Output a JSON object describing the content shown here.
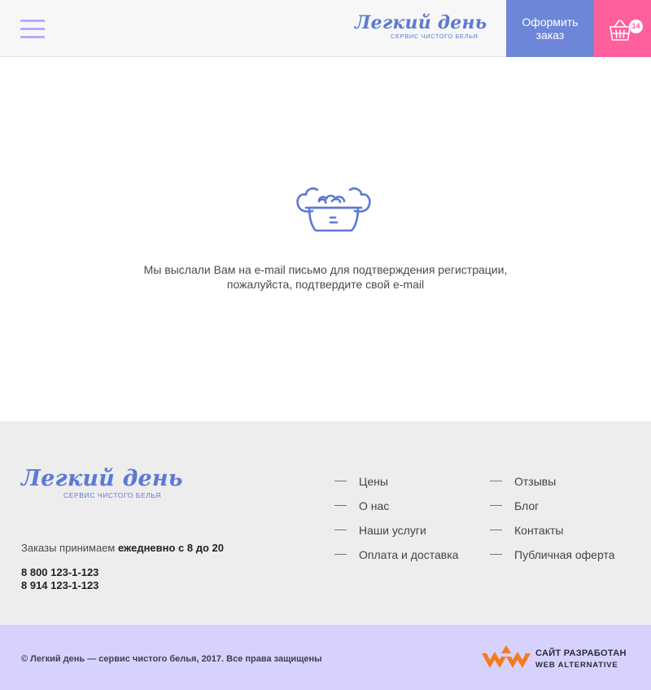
{
  "header": {
    "logo_main": "Легкий день",
    "logo_sub": "СЕРВИС ЧИСТОГО БЕЛЬЯ",
    "order_button": "Оформить заказ",
    "cart_count": "14"
  },
  "main": {
    "icon": "laundry-basin-icon",
    "message_line1": "Мы выслали Вам на e-mail письмо для подтверждения регистрации,",
    "message_line2": "пожалуйста, подтвердите свой e-mail"
  },
  "footer": {
    "logo_main": "Легкий день",
    "logo_sub": "СЕРВИС ЧИСТОГО БЕЛЬЯ",
    "orders_prefix": "Заказы  принимаем ",
    "orders_bold": "ежедневно с 8 до 20",
    "phone1": "8 800 123-1-123",
    "phone2": "8 914  123-1-123",
    "nav_col1": [
      "Цены",
      "О нас",
      "Наши услуги",
      "Оплата и доставка"
    ],
    "nav_col2": [
      "Отзывы",
      "Блог",
      "Контакты",
      "Публичная оферта"
    ]
  },
  "bottom": {
    "copyright": "© Легкий день — сервис чистого белья, 2017. Все права защищены",
    "dev_line1": "САЙТ РАЗРАБОТАН",
    "dev_line2": "WEB ALTERNATIVE"
  },
  "colors": {
    "brand_blue": "#5d79d4",
    "order_button_bg": "#6e86d8",
    "cart_bg": "#ff5f9c",
    "burger": "#b7a8ff",
    "bottom_bar_bg": "#d6d2fd",
    "dev_logo_orange": "#f47b20"
  }
}
